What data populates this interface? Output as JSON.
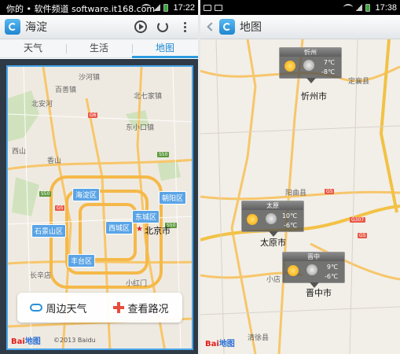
{
  "left_phone": {
    "status": {
      "time": "17:22",
      "watermark": "你的 • 软件频道 software.it168.com"
    },
    "header": {
      "title": "海淀"
    },
    "tabs": [
      {
        "label": "天气"
      },
      {
        "label": "生活"
      },
      {
        "label": "地图"
      }
    ],
    "active_tab": "地图",
    "map": {
      "districts": [
        {
          "name": "海淀区"
        },
        {
          "name": "朝阳区"
        },
        {
          "name": "东城区"
        },
        {
          "name": "西城区"
        },
        {
          "name": "石景山区"
        },
        {
          "name": "丰台区"
        }
      ],
      "city": "北京市",
      "places": [
        "沙河镇",
        "东小口镇",
        "北七家镇",
        "北安河",
        "西山",
        "长辛店",
        "小红门",
        "香山",
        "百善镇"
      ],
      "road_labels": [
        "G6",
        "S50",
        "S50",
        "G5",
        "S50"
      ],
      "copyright": "©2013 Baidu"
    },
    "bottom_buttons": {
      "nearby_weather": "周边天气",
      "traffic": "查看路况"
    },
    "logo": {
      "bai": "Bai",
      "du": "地图"
    }
  },
  "right_phone": {
    "status": {
      "time": "17:38"
    },
    "header": {
      "title": "地图"
    },
    "weather_pins": [
      {
        "city": "忻州",
        "high": "7℃",
        "low": "-8℃",
        "label": "忻州市"
      },
      {
        "city": "太原",
        "high": "10℃",
        "low": "-6℃",
        "label": "太原市"
      },
      {
        "city": "晋中",
        "high": "9℃",
        "low": "-6℃",
        "label": "晋中市"
      }
    ],
    "places": [
      "定襄县",
      "阳曲县",
      "清徐县",
      "小店"
    ],
    "road_labels": [
      "G5",
      "G307",
      "G5"
    ],
    "logo": {
      "bai": "Bai",
      "du": "地图"
    }
  }
}
